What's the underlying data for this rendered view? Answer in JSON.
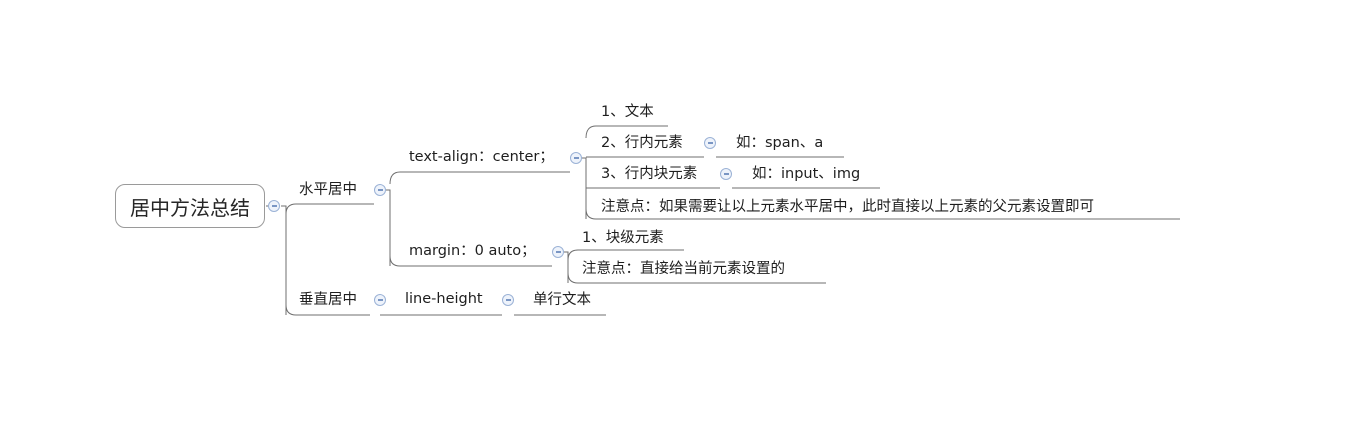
{
  "map": {
    "root": "居中方法总结",
    "horizontal": {
      "label": "水平居中",
      "text_align": {
        "label": "text-align：center；",
        "items": [
          "1、文本",
          "2、行内元素",
          "3、行内块元素",
          "注意点：如果需要让以上元素水平居中，此时直接以上元素的父元素设置即可"
        ],
        "inline_example": "如：span、a",
        "inline_block_example": "如：input、img"
      },
      "margin": {
        "label": "margin：0 auto；",
        "items": [
          "1、块级元素",
          "注意点：直接给当前元素设置的"
        ]
      }
    },
    "vertical": {
      "label": "垂直居中",
      "line_height": {
        "label": "line-height",
        "child": "单行文本"
      }
    }
  },
  "colors": {
    "line": "#6f6f6f",
    "toggle_border": "#9bb2d6",
    "toggle_fill": "#eef3fb"
  },
  "icons": {
    "collapse": "collapse-icon"
  }
}
